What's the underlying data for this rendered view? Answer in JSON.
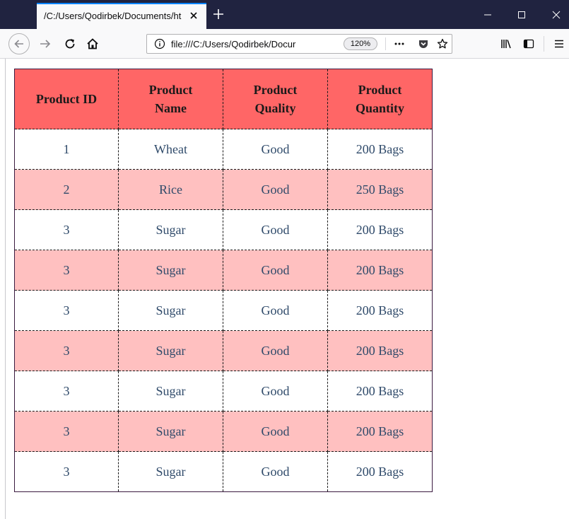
{
  "window": {
    "tab_title": "/C:/Users/Qodirbek/Documents/ht",
    "icons": {
      "close_tab": "close-icon",
      "new_tab": "plus-icon",
      "minimize": "minimize-icon",
      "maximize": "maximize-icon",
      "close_window": "close-icon"
    },
    "titlebar_color": "#202340",
    "accent_color": "#0a84ff"
  },
  "navbar": {
    "url": "file:///C:/Users/Qodirbek/Docur",
    "zoom": "120%",
    "icons": [
      "back-arrow-icon",
      "forward-arrow-icon",
      "reload-icon",
      "home-icon",
      "info-icon",
      "more-dots-icon",
      "pocket-icon",
      "star-icon",
      "library-icon",
      "sidebar-icon",
      "hamburger-menu-icon"
    ]
  },
  "table": {
    "headers": [
      "Product ID",
      "Product Name",
      "Product Quality",
      "Product Quantity"
    ],
    "rows": [
      [
        "1",
        "Wheat",
        "Good",
        "200 Bags"
      ],
      [
        "2",
        "Rice",
        "Good",
        "250 Bags"
      ],
      [
        "3",
        "Sugar",
        "Good",
        "200 Bags"
      ],
      [
        "3",
        "Sugar",
        "Good",
        "200 Bags"
      ],
      [
        "3",
        "Sugar",
        "Good",
        "200 Bags"
      ],
      [
        "3",
        "Sugar",
        "Good",
        "200 Bags"
      ],
      [
        "3",
        "Sugar",
        "Good",
        "200 Bags"
      ],
      [
        "3",
        "Sugar",
        "Good",
        "200 Bags"
      ],
      [
        "3",
        "Sugar",
        "Good",
        "200 Bags"
      ]
    ],
    "colors": {
      "header_bg": "#ff6666",
      "even_row_bg": "#ffc0c0",
      "odd_row_bg": "#ffffff",
      "cell_text": "#2f4a6a"
    }
  }
}
